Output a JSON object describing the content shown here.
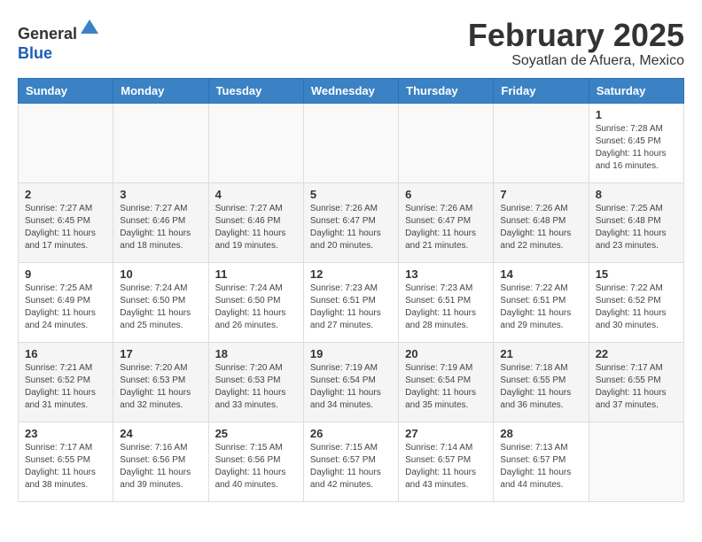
{
  "header": {
    "logo_general": "General",
    "logo_blue": "Blue",
    "month_title": "February 2025",
    "subtitle": "Soyatlan de Afuera, Mexico"
  },
  "weekdays": [
    "Sunday",
    "Monday",
    "Tuesday",
    "Wednesday",
    "Thursday",
    "Friday",
    "Saturday"
  ],
  "weeks": [
    [
      {
        "day": "",
        "info": ""
      },
      {
        "day": "",
        "info": ""
      },
      {
        "day": "",
        "info": ""
      },
      {
        "day": "",
        "info": ""
      },
      {
        "day": "",
        "info": ""
      },
      {
        "day": "",
        "info": ""
      },
      {
        "day": "1",
        "info": "Sunrise: 7:28 AM\nSunset: 6:45 PM\nDaylight: 11 hours\nand 16 minutes."
      }
    ],
    [
      {
        "day": "2",
        "info": "Sunrise: 7:27 AM\nSunset: 6:45 PM\nDaylight: 11 hours\nand 17 minutes."
      },
      {
        "day": "3",
        "info": "Sunrise: 7:27 AM\nSunset: 6:46 PM\nDaylight: 11 hours\nand 18 minutes."
      },
      {
        "day": "4",
        "info": "Sunrise: 7:27 AM\nSunset: 6:46 PM\nDaylight: 11 hours\nand 19 minutes."
      },
      {
        "day": "5",
        "info": "Sunrise: 7:26 AM\nSunset: 6:47 PM\nDaylight: 11 hours\nand 20 minutes."
      },
      {
        "day": "6",
        "info": "Sunrise: 7:26 AM\nSunset: 6:47 PM\nDaylight: 11 hours\nand 21 minutes."
      },
      {
        "day": "7",
        "info": "Sunrise: 7:26 AM\nSunset: 6:48 PM\nDaylight: 11 hours\nand 22 minutes."
      },
      {
        "day": "8",
        "info": "Sunrise: 7:25 AM\nSunset: 6:48 PM\nDaylight: 11 hours\nand 23 minutes."
      }
    ],
    [
      {
        "day": "9",
        "info": "Sunrise: 7:25 AM\nSunset: 6:49 PM\nDaylight: 11 hours\nand 24 minutes."
      },
      {
        "day": "10",
        "info": "Sunrise: 7:24 AM\nSunset: 6:50 PM\nDaylight: 11 hours\nand 25 minutes."
      },
      {
        "day": "11",
        "info": "Sunrise: 7:24 AM\nSunset: 6:50 PM\nDaylight: 11 hours\nand 26 minutes."
      },
      {
        "day": "12",
        "info": "Sunrise: 7:23 AM\nSunset: 6:51 PM\nDaylight: 11 hours\nand 27 minutes."
      },
      {
        "day": "13",
        "info": "Sunrise: 7:23 AM\nSunset: 6:51 PM\nDaylight: 11 hours\nand 28 minutes."
      },
      {
        "day": "14",
        "info": "Sunrise: 7:22 AM\nSunset: 6:51 PM\nDaylight: 11 hours\nand 29 minutes."
      },
      {
        "day": "15",
        "info": "Sunrise: 7:22 AM\nSunset: 6:52 PM\nDaylight: 11 hours\nand 30 minutes."
      }
    ],
    [
      {
        "day": "16",
        "info": "Sunrise: 7:21 AM\nSunset: 6:52 PM\nDaylight: 11 hours\nand 31 minutes."
      },
      {
        "day": "17",
        "info": "Sunrise: 7:20 AM\nSunset: 6:53 PM\nDaylight: 11 hours\nand 32 minutes."
      },
      {
        "day": "18",
        "info": "Sunrise: 7:20 AM\nSunset: 6:53 PM\nDaylight: 11 hours\nand 33 minutes."
      },
      {
        "day": "19",
        "info": "Sunrise: 7:19 AM\nSunset: 6:54 PM\nDaylight: 11 hours\nand 34 minutes."
      },
      {
        "day": "20",
        "info": "Sunrise: 7:19 AM\nSunset: 6:54 PM\nDaylight: 11 hours\nand 35 minutes."
      },
      {
        "day": "21",
        "info": "Sunrise: 7:18 AM\nSunset: 6:55 PM\nDaylight: 11 hours\nand 36 minutes."
      },
      {
        "day": "22",
        "info": "Sunrise: 7:17 AM\nSunset: 6:55 PM\nDaylight: 11 hours\nand 37 minutes."
      }
    ],
    [
      {
        "day": "23",
        "info": "Sunrise: 7:17 AM\nSunset: 6:55 PM\nDaylight: 11 hours\nand 38 minutes."
      },
      {
        "day": "24",
        "info": "Sunrise: 7:16 AM\nSunset: 6:56 PM\nDaylight: 11 hours\nand 39 minutes."
      },
      {
        "day": "25",
        "info": "Sunrise: 7:15 AM\nSunset: 6:56 PM\nDaylight: 11 hours\nand 40 minutes."
      },
      {
        "day": "26",
        "info": "Sunrise: 7:15 AM\nSunset: 6:57 PM\nDaylight: 11 hours\nand 42 minutes."
      },
      {
        "day": "27",
        "info": "Sunrise: 7:14 AM\nSunset: 6:57 PM\nDaylight: 11 hours\nand 43 minutes."
      },
      {
        "day": "28",
        "info": "Sunrise: 7:13 AM\nSunset: 6:57 PM\nDaylight: 11 hours\nand 44 minutes."
      },
      {
        "day": "",
        "info": ""
      }
    ]
  ]
}
